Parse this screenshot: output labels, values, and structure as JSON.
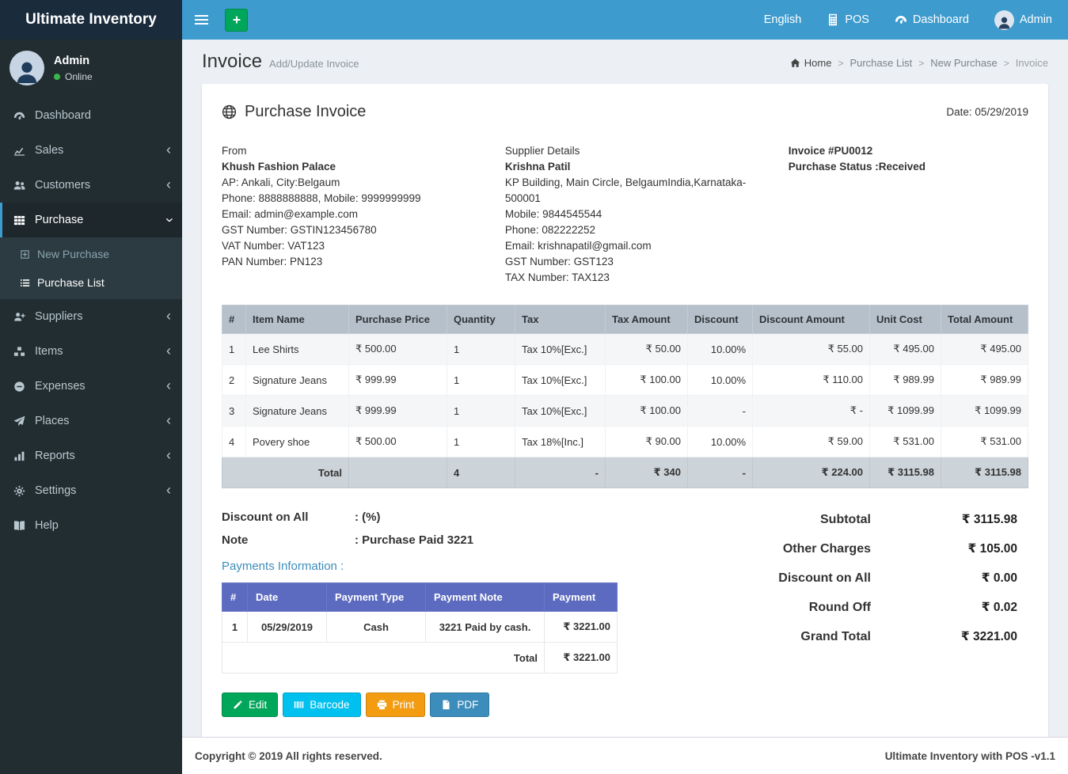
{
  "topbar": {
    "brand": "Ultimate Inventory",
    "language": "English",
    "pos": "POS",
    "dashboard": "Dashboard",
    "user": "Admin"
  },
  "sidebar": {
    "user": {
      "name": "Admin",
      "status": "Online"
    },
    "items": [
      {
        "label": "Dashboard"
      },
      {
        "label": "Sales"
      },
      {
        "label": "Customers"
      },
      {
        "label": "Purchase",
        "children": [
          "New Purchase",
          "Purchase List"
        ]
      },
      {
        "label": "Suppliers"
      },
      {
        "label": "Items"
      },
      {
        "label": "Expenses"
      },
      {
        "label": "Places"
      },
      {
        "label": "Reports"
      },
      {
        "label": "Settings"
      },
      {
        "label": "Help"
      }
    ]
  },
  "content_header": {
    "title": "Invoice",
    "subtitle": "Add/Update Invoice",
    "breadcrumb": [
      "Home",
      "Purchase List",
      "New Purchase",
      "Invoice"
    ]
  },
  "invoice": {
    "title": "Purchase Invoice",
    "date": "Date: 05/29/2019",
    "from": {
      "label": "From",
      "name": "Khush Fashion Palace",
      "lines": [
        "AP: Ankali, City:Belgaum",
        "Phone: 8888888888, Mobile: 9999999999",
        "Email: admin@example.com",
        "GST Number: GSTIN123456780",
        "VAT Number: VAT123",
        "PAN Number: PN123"
      ]
    },
    "supplier": {
      "label": "Supplier Details",
      "name": "Krishna Patil",
      "lines": [
        "KP Building, Main Circle, BelgaumIndia,Karnataka-500001",
        "Mobile: 9844545544",
        "Phone: 082222252",
        "Email: krishnapatil@gmail.com",
        "GST Number: GST123",
        "TAX Number: TAX123"
      ]
    },
    "meta": {
      "number": "Invoice #PU0012",
      "status": "Purchase Status :Received"
    }
  },
  "items_table": {
    "headers": [
      "#",
      "Item Name",
      "Purchase Price",
      "Quantity",
      "Tax",
      "Tax Amount",
      "Discount",
      "Discount Amount",
      "Unit Cost",
      "Total Amount"
    ],
    "rows": [
      [
        "1",
        "Lee Shirts",
        "₹ 500.00",
        "1",
        "Tax 10%[Exc.]",
        "₹ 50.00",
        "10.00%",
        "₹ 55.00",
        "₹ 495.00",
        "₹ 495.00"
      ],
      [
        "2",
        "Signature Jeans",
        "₹ 999.99",
        "1",
        "Tax 10%[Exc.]",
        "₹ 100.00",
        "10.00%",
        "₹ 110.00",
        "₹ 989.99",
        "₹ 989.99"
      ],
      [
        "3",
        "Signature Jeans",
        "₹ 999.99",
        "1",
        "Tax 10%[Exc.]",
        "₹ 100.00",
        "-",
        "₹ -",
        "₹ 1099.99",
        "₹ 1099.99"
      ],
      [
        "4",
        "Povery shoe",
        "₹ 500.00",
        "1",
        "Tax 18%[Inc.]",
        "₹ 90.00",
        "10.00%",
        "₹ 59.00",
        "₹ 531.00",
        "₹ 531.00"
      ]
    ],
    "total": {
      "label": "Total",
      "quantity": "4",
      "tax": "-",
      "tax_amount": "₹ 340",
      "discount": "-",
      "discount_amount": "₹ 224.00",
      "unit_cost": "₹ 3115.98",
      "total_amount": "₹ 3115.98"
    }
  },
  "notes": {
    "discount_label": "Discount on All",
    "discount_value": ": (%)",
    "note_label": "Note",
    "note_value": ": Purchase Paid 3221"
  },
  "payments": {
    "title": "Payments Information :",
    "headers": [
      "#",
      "Date",
      "Payment Type",
      "Payment Note",
      "Payment"
    ],
    "rows": [
      [
        "1",
        "05/29/2019",
        "Cash",
        "3221 Paid by cash.",
        "₹ 3221.00"
      ]
    ],
    "total_label": "Total",
    "total_value": "₹ 3221.00"
  },
  "summary": [
    {
      "label": "Subtotal",
      "value": "₹ 3115.98"
    },
    {
      "label": "Other Charges",
      "value": "₹ 105.00"
    },
    {
      "label": "Discount on All",
      "value": "₹ 0.00"
    },
    {
      "label": "Round Off",
      "value": "₹ 0.02"
    },
    {
      "label": "Grand Total",
      "value": "₹ 3221.00"
    }
  ],
  "actions": [
    {
      "label": "Edit",
      "color": "#00a65a"
    },
    {
      "label": "Barcode",
      "color": "#00c0ef"
    },
    {
      "label": "Print",
      "color": "#f39c12"
    },
    {
      "label": "PDF",
      "color": "#3c8dbc"
    }
  ],
  "footer": {
    "left": "Copyright © 2019 All rights reserved.",
    "right": "Ultimate Inventory with POS -v1.1"
  },
  "colors": {
    "topbar": "#3d9bce",
    "brand_bg": "#1a2b3c",
    "sidebar_bg": "#222d32",
    "items_header_bg": "#b6c0ca",
    "payments_header_bg": "#5c6bc0",
    "online_dot": "#3cb54a",
    "link_blue": "#3c8dbc"
  },
  "icons": {
    "hamburger-icon": "≡",
    "plus-icon": "+",
    "pos-icon": "calculator",
    "dashboard-icon": "gauge",
    "home-icon": "house",
    "globe-icon": "globe",
    "edit-icon": "pencil",
    "barcode-icon": "barcode",
    "print-icon": "printer",
    "pdf-icon": "file",
    "chevron-left-icon": "‹",
    "chevron-down-icon": "v"
  }
}
